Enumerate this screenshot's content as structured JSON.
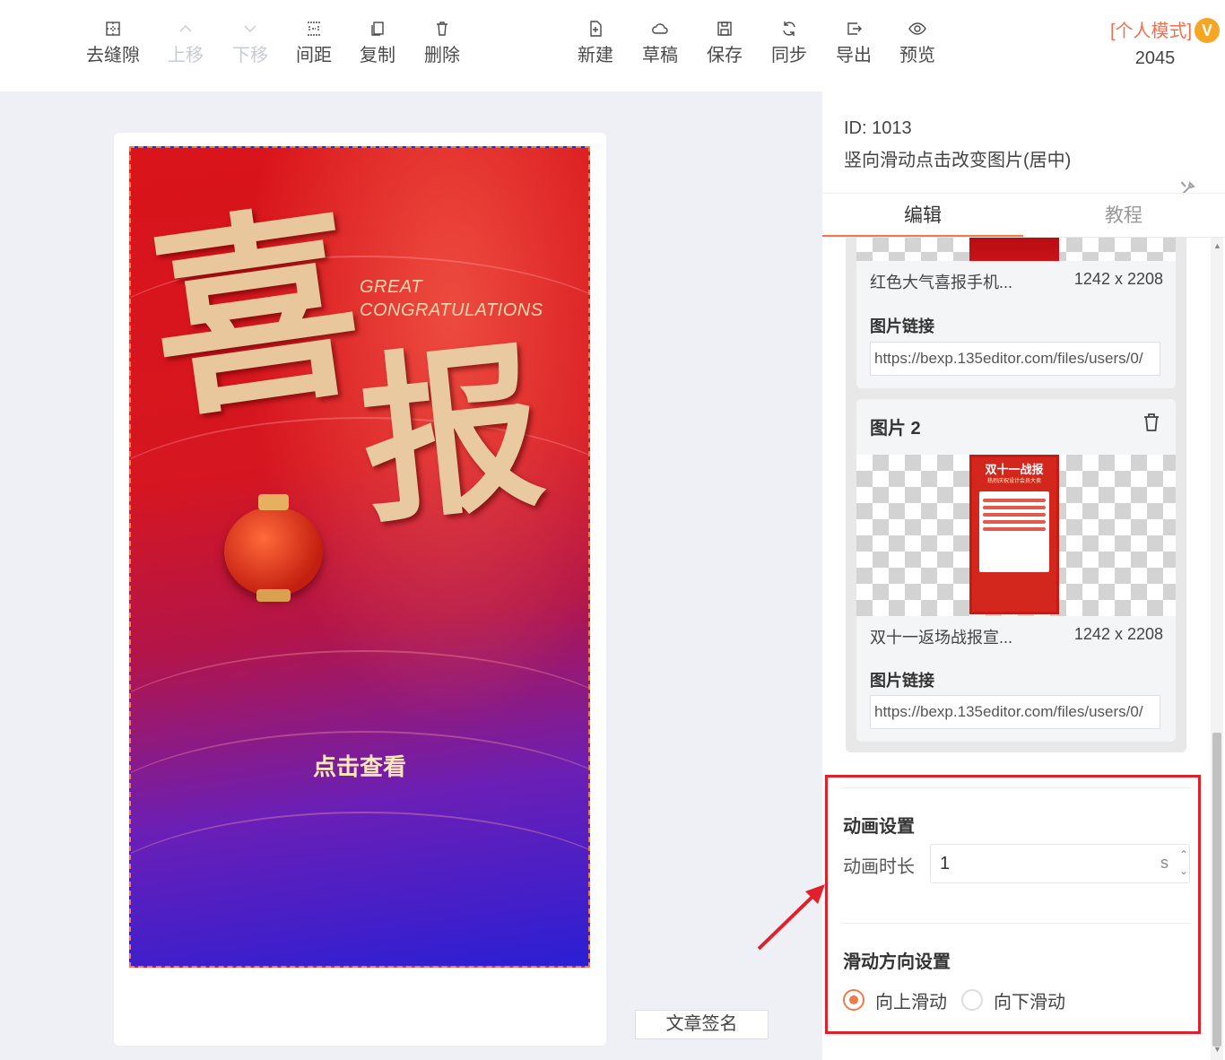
{
  "toolbar": {
    "left_tools": [
      {
        "label": "去缝隙",
        "icon": "grid-icon",
        "disabled": false
      },
      {
        "label": "上移",
        "icon": "chevron-up-icon",
        "disabled": true
      },
      {
        "label": "下移",
        "icon": "chevron-down-icon",
        "disabled": true
      },
      {
        "label": "间距",
        "icon": "spacing-icon",
        "disabled": false
      },
      {
        "label": "复制",
        "icon": "copy-icon",
        "disabled": false
      },
      {
        "label": "删除",
        "icon": "trash-icon",
        "disabled": false
      }
    ],
    "right_tools": [
      {
        "label": "新建",
        "icon": "new-file-icon"
      },
      {
        "label": "草稿",
        "icon": "cloud-icon"
      },
      {
        "label": "保存",
        "icon": "save-icon"
      },
      {
        "label": "同步",
        "icon": "sync-icon"
      },
      {
        "label": "导出",
        "icon": "export-icon"
      },
      {
        "label": "预览",
        "icon": "eye-icon"
      }
    ],
    "mode_label": "[个人模式]",
    "vip_badge": "V",
    "count": "2045"
  },
  "canvas": {
    "poster": {
      "main_char_1": "喜",
      "main_char_2": "报",
      "great": "GREAT",
      "congratulations": "CONGRATULATIONS",
      "click_view": "点击查看"
    },
    "sign_button": "文章签名"
  },
  "panel": {
    "id_line": "ID: 1013",
    "title": "竖向滑动点击改变图片(居中)",
    "tabs": [
      {
        "label": "编辑",
        "active": true
      },
      {
        "label": "教程",
        "active": false
      }
    ],
    "images": [
      {
        "name": "红色大气喜报手机...",
        "size": "1242 x 2208",
        "link_label": "图片链接",
        "link": "https://bexp.135editor.com/files/users/0/"
      },
      {
        "title": "图片 2",
        "name": "双十一返场战报宣...",
        "size": "1242 x 2208",
        "link_label": "图片链接",
        "link": "https://bexp.135editor.com/files/users/0/",
        "thumb_head": "双十一战报",
        "thumb_sub": "热烈庆祝设计会员大卖"
      }
    ],
    "animation": {
      "section_title": "动画设置",
      "duration_label": "动画时长",
      "duration_value": "1",
      "duration_unit": "s"
    },
    "direction": {
      "section_title": "滑动方向设置",
      "options": [
        {
          "label": "向上滑动",
          "checked": true
        },
        {
          "label": "向下滑动",
          "checked": false
        }
      ]
    }
  },
  "colors": {
    "accent": "#f07a4a",
    "highlight_box": "#e0202a",
    "mode_text": "#f07050",
    "vip_badge": "#f5a623"
  }
}
